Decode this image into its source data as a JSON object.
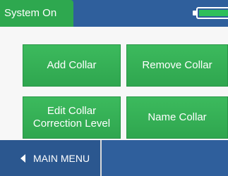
{
  "status_bar": {
    "status_text": "System On",
    "battery_icon": "battery-icon",
    "battery_level": 1.0
  },
  "menu": {
    "buttons": [
      {
        "label_lines": [
          "Add Collar"
        ]
      },
      {
        "label_lines": [
          "Remove Collar"
        ]
      },
      {
        "label_lines": [
          "Edit Collar",
          "Correction Level"
        ]
      },
      {
        "label_lines": [
          "Name Collar"
        ]
      }
    ]
  },
  "footer": {
    "back_icon": "back-arrow-icon",
    "back_label": "MAIN MENU"
  },
  "colors": {
    "header_blue": "#2f5f9c",
    "status_green": "#2ea84f",
    "button_green": "#3cba5d"
  }
}
